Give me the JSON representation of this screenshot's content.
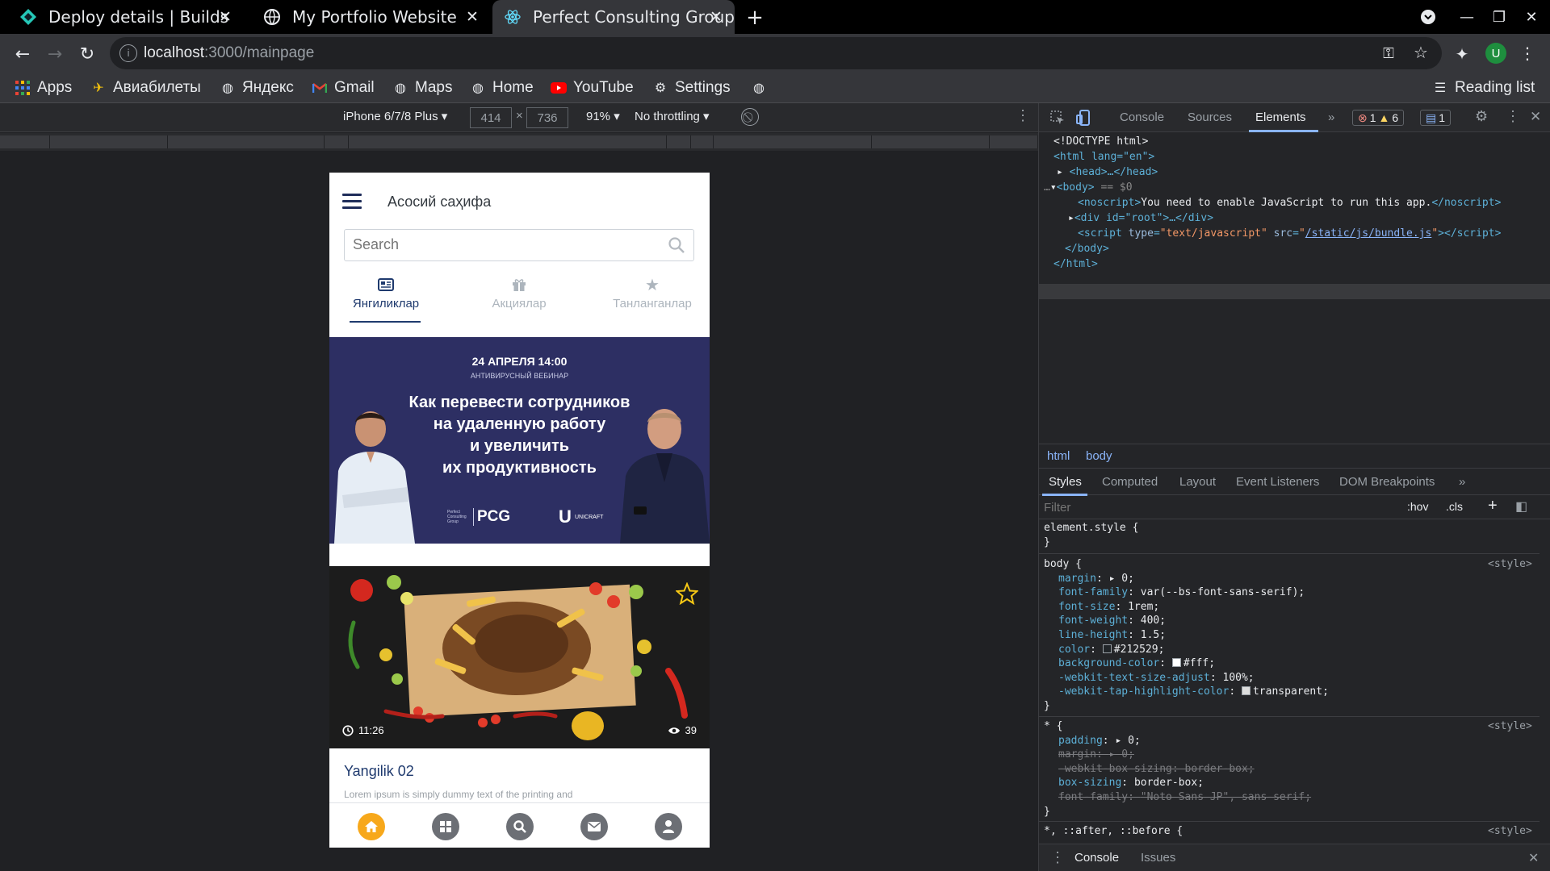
{
  "browser": {
    "tabs": [
      {
        "title": "Deploy details | Builds",
        "icon": "netlify-icon"
      },
      {
        "title": "My Portfolio Website",
        "icon": "globe-icon"
      },
      {
        "title": "Perfect Consulting Group",
        "icon": "react-icon"
      }
    ],
    "active_tab": 2,
    "url_host": "localhost",
    "url_path": ":3000/mainpage",
    "profile_initial": "U",
    "bookmarks": [
      {
        "label": "Apps",
        "icon": "apps-grid-icon"
      },
      {
        "label": "Авиабилеты",
        "icon": "plane-icon"
      },
      {
        "label": "Яндекс",
        "icon": "globe-icon"
      },
      {
        "label": "Gmail",
        "icon": "gmail-icon"
      },
      {
        "label": "Maps",
        "icon": "globe-icon"
      },
      {
        "label": "Home",
        "icon": "globe-icon"
      },
      {
        "label": "YouTube",
        "icon": "youtube-icon"
      },
      {
        "label": "Settings",
        "icon": "gear-icon"
      }
    ],
    "reading_list": "Reading list"
  },
  "device_toolbar": {
    "device": "iPhone 6/7/8 Plus",
    "width": "414",
    "height": "736",
    "zoom": "91%",
    "throttling": "No throttling"
  },
  "app": {
    "page_title": "Асосий саҳифа",
    "search_placeholder": "Search",
    "tabs": [
      {
        "label": "Янгиликлар",
        "icon": "newspaper-icon",
        "active": true
      },
      {
        "label": "Акциялар",
        "icon": "gift-icon",
        "active": false
      },
      {
        "label": "Танланганлар",
        "icon": "star-icon",
        "active": false
      }
    ],
    "banner": {
      "date": "24 АПРЕЛЯ 14:00",
      "subtitle": "АНТИВИРУСНЫЙ ВЕБИНАР",
      "headline": [
        "Как перевести сотрудников",
        "на удаленную работу",
        "и увеличить",
        "их продуктивность"
      ],
      "logo_small": "Perfect Consulting Group",
      "logo_pcg": "PCG",
      "logo_unicraft": "UNICRAFT"
    },
    "news_card": {
      "time": "11:26",
      "views": "39",
      "title": "Yangilik 02",
      "excerpt": "Lorem ipsum is simply dummy text of the printing and"
    },
    "bottom_nav": [
      "home-icon",
      "grid-icon",
      "search-icon",
      "mail-icon",
      "user-icon"
    ]
  },
  "devtools": {
    "tabs": [
      "Console",
      "Sources",
      "Elements"
    ],
    "active_tab": "Elements",
    "errors": "1",
    "warnings": "6",
    "messages": "1",
    "dom": {
      "doctype": "<!DOCTYPE html>",
      "html_open": "<html lang=\"en\">",
      "head": "<head>…</head>",
      "body_open": "<body>",
      "body_marker": "== $0",
      "noscript_text": "You need to enable JavaScript to run this app.",
      "root_div": "<div id=\"root\">…</div>",
      "script_src": "/static/js/bundle.js",
      "body_close": "</body>",
      "html_close": "</html>"
    },
    "breadcrumbs": [
      "html",
      "body"
    ],
    "subtabs": [
      "Styles",
      "Computed",
      "Layout",
      "Event Listeners",
      "DOM Breakpoints"
    ],
    "filter_placeholder": "Filter",
    "filter_hov": ":hov",
    "filter_cls": ".cls",
    "rules": {
      "element_style": "element.style {",
      "body_selector": "body {",
      "body_source": "<style>",
      "body_props": [
        {
          "name": "margin",
          "value": "▸ 0;"
        },
        {
          "name": "font-family",
          "value": "var(--bs-font-sans-serif);"
        },
        {
          "name": "font-size",
          "value": "1rem;"
        },
        {
          "name": "font-weight",
          "value": "400;"
        },
        {
          "name": "line-height",
          "value": "1.5;"
        },
        {
          "name": "color",
          "value": "#212529;"
        },
        {
          "name": "background-color",
          "value": "#fff;"
        },
        {
          "name": "-webkit-text-size-adjust",
          "value": "100%;"
        },
        {
          "name": "-webkit-tap-highlight-color",
          "value": "transparent;"
        }
      ],
      "star_selector": "* {",
      "star_props": [
        {
          "name": "padding",
          "value": "▸ 0;"
        },
        {
          "name": "margin",
          "value": "▸ 0;"
        },
        {
          "name": "-webkit-box-sizing",
          "value": "border-box;"
        },
        {
          "name": "box-sizing",
          "value": "border-box;"
        },
        {
          "name": "font-family",
          "value": "\"Noto Sans JP\", sans-serif;"
        }
      ],
      "after_selector": "*, ::after, ::before {"
    },
    "drawer_tabs": [
      "Console",
      "Issues"
    ]
  },
  "colors": {
    "accent_nav": "#f7a81b",
    "banner_bg": "#2d2f63",
    "title_blue": "#1f3a6e"
  }
}
